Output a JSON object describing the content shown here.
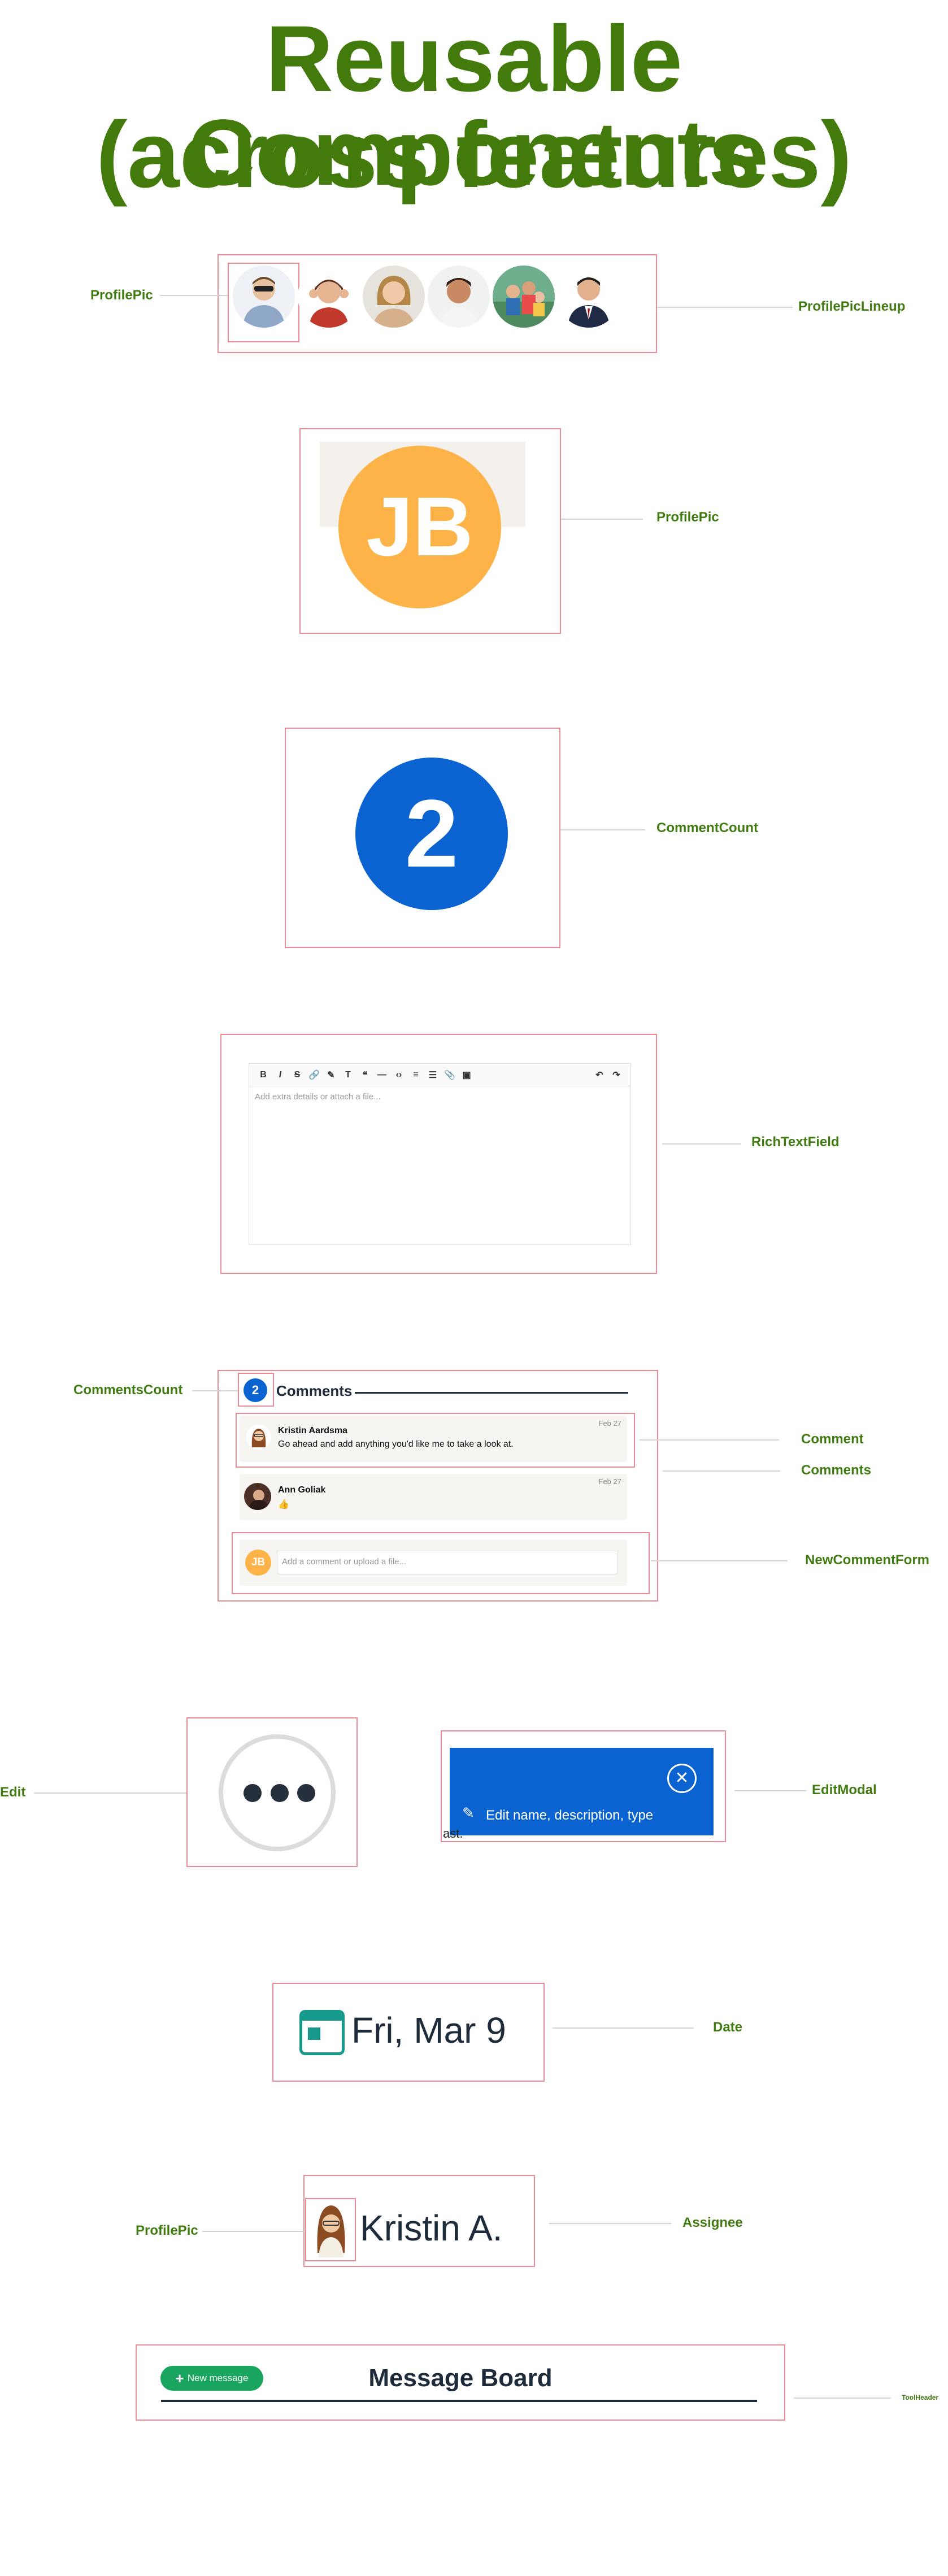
{
  "title": {
    "line1": "Reusable Components",
    "line2": "(across features)"
  },
  "labels": {
    "profile_pic_1": "ProfilePic",
    "profile_pic_lineup": "ProfilePicLineup",
    "profile_pic_2": "ProfilePic",
    "comment_count": "CommentCount",
    "rich_text_field": "RichTextField",
    "comments_count": "CommentsCount",
    "comment": "Comment",
    "comments": "Comments",
    "new_comment_form": "NewCommentForm",
    "edit": "Edit",
    "edit_modal": "EditModal",
    "date": "Date",
    "profile_pic_3": "ProfilePic",
    "assignee": "Assignee",
    "tool_header": "ToolHeader"
  },
  "jb_avatar": {
    "initials": "JB",
    "color": "#fdb347"
  },
  "comment_badge": {
    "count": "2",
    "color": "#0b63d1"
  },
  "rich_text": {
    "toolbar": [
      "B",
      "I",
      "S",
      "🔗",
      "✎",
      "T",
      "❝",
      "—",
      "‹›",
      "≡",
      "☰",
      "📎",
      "▣"
    ],
    "undo": "↶",
    "redo": "↷",
    "placeholder": "Add extra details or attach a file..."
  },
  "comments_section": {
    "count": "2",
    "heading": "Comments",
    "items": [
      {
        "author": "Kristin Aardsma",
        "text": "Go ahead and add anything you'd like me to take a look at.",
        "date": "Feb 27"
      },
      {
        "author": "Ann Goliak",
        "text": "👍",
        "date": "Feb 27"
      }
    ],
    "new_comment_initials": "JB",
    "new_comment_placeholder": "Add a comment or upload a file..."
  },
  "edit_modal": {
    "text": "Edit name, description, type",
    "fragment": "ast."
  },
  "date_widget": {
    "text": "Fri, Mar 9"
  },
  "assignee_widget": {
    "name": "Kristin A."
  },
  "tool_header": {
    "button": "New message",
    "plus": "+",
    "title": "Message Board"
  }
}
